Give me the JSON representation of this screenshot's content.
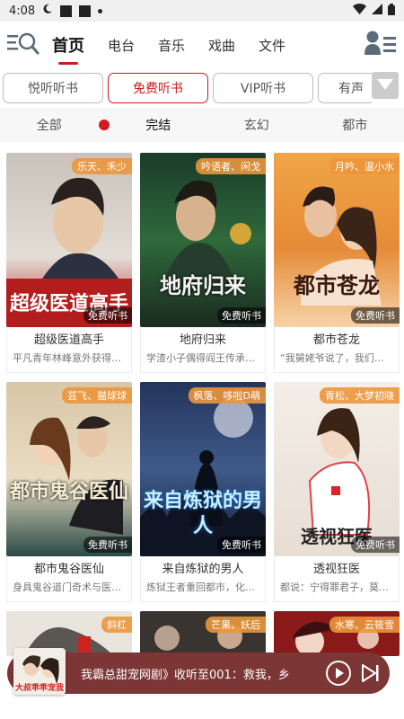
{
  "status": {
    "time": "4:08"
  },
  "nav": {
    "tabs": [
      {
        "label": "首页"
      },
      {
        "label": "电台"
      },
      {
        "label": "音乐"
      },
      {
        "label": "戏曲"
      },
      {
        "label": "文件"
      }
    ]
  },
  "categories": [
    {
      "label": "悦听听书"
    },
    {
      "label": "免费听书"
    },
    {
      "label": "VIP听书"
    },
    {
      "label": "有声"
    }
  ],
  "filters": [
    {
      "label": "全部"
    },
    {
      "label": "完结"
    },
    {
      "label": "玄幻"
    },
    {
      "label": "都市"
    }
  ],
  "books": [
    {
      "title": "超级医道高手",
      "author": "乐天、禾少",
      "desc": "平凡青年林峰意外获得…",
      "badge": "免费听书",
      "cover_text": "超级医道高手"
    },
    {
      "title": "地府归来",
      "author": "吟语者、闲戈",
      "desc": "学渣小子偶得阎王传承…",
      "badge": "免费听书",
      "cover_text": "地府归来"
    },
    {
      "title": "都市苍龙",
      "author": "月吟、温小水",
      "desc": "“我舅姥爷说了，我们杨…",
      "badge": "免费听书",
      "cover_text": "都市苍龙"
    },
    {
      "title": "都市鬼谷医仙",
      "author": "芸飞、猫球球",
      "desc": "身具鬼谷道门奇术与医…",
      "badge": "免费听书",
      "cover_text": "都市鬼谷医仙"
    },
    {
      "title": "来自炼狱的男人",
      "author": "枫落、哆啦D萌",
      "desc": "炼狱王者重回都市，化…",
      "badge": "免费听书",
      "cover_text": "来自炼狱的男人"
    },
    {
      "title": "透视狂医",
      "author": "青松、大梦初晓",
      "desc": "都说：宁得罪君子，莫…",
      "badge": "免费听书",
      "cover_text": "透视狂医"
    },
    {
      "author": "斜杠"
    },
    {
      "author": "芒果、妖后"
    },
    {
      "author": "水寒、云筱雪"
    }
  ],
  "player": {
    "text": "我霸总甜宠网剧》收听至001：救我，乡",
    "cover_text": "大叔乖乖宠我"
  },
  "icons": {
    "search_menu": "search-menu-icon",
    "user": "user-list-icon",
    "dropdown": "chevron-down-icon",
    "play": "play-icon",
    "next": "skip-next-icon"
  }
}
